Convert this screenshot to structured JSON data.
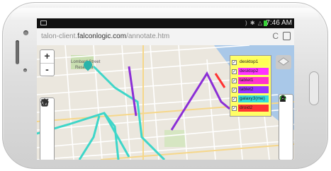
{
  "status_bar": {
    "icons": ") ✱ △",
    "time": "7:46 AM",
    "battery_color": "#3ad23a"
  },
  "browser": {
    "url_prefix": "talon-client.",
    "url_host": "falconlogic.com",
    "url_path": "/annotate.htm",
    "reload_icon": "C"
  },
  "map": {
    "zoom_in": "+",
    "zoom_out": "-",
    "places": {
      "park_line1": "Lombard Street",
      "park_line2": "Reservoir"
    },
    "tools": [
      "line-tool",
      "polygon-tool",
      "rectangle-tool",
      "marker-tool",
      "edit-tool"
    ],
    "right_tools": [
      "layer-icon",
      "wifi-icon",
      "info-icon",
      "swap-icon",
      "refresh-icon",
      "user-icon"
    ]
  },
  "legend": {
    "items": [
      {
        "label": "desktop1",
        "color": "#ffff55",
        "checked": true
      },
      {
        "label": "desktop2",
        "color": "#ff33ff",
        "checked": true
      },
      {
        "label": "tablet1",
        "color": "#ff33cc",
        "checked": true
      },
      {
        "label": "tablet2",
        "color": "#9933ff",
        "checked": true
      },
      {
        "label": "galaxy3(me)",
        "color": "#33dddd",
        "checked": true
      },
      {
        "label": "droid2",
        "color": "#ff3333",
        "checked": true
      }
    ]
  },
  "colors": {
    "route_teal": "#3ed6c9",
    "route_purple": "#8b2fd6",
    "route_red": "#ff3333"
  }
}
